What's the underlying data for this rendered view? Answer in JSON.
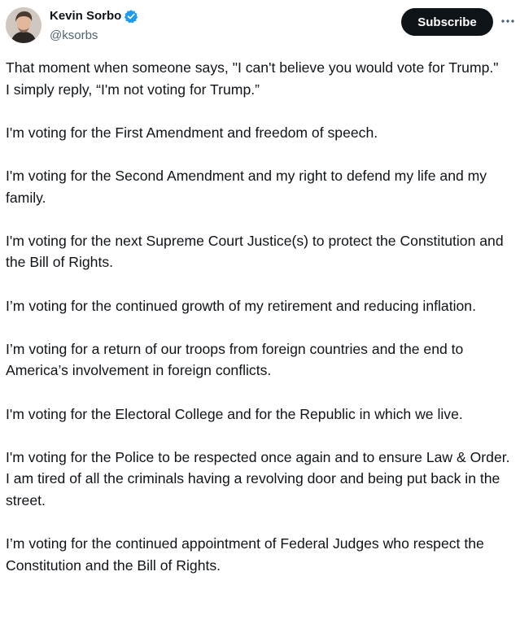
{
  "author": {
    "display_name": "Kevin Sorbo",
    "handle": "@ksorbs",
    "verified_color": "#1d9bf0"
  },
  "actions": {
    "subscribe_label": "Subscribe",
    "more_icon": "more-horizontal-icon"
  },
  "post": {
    "paragraphs": [
      "That moment when someone says, \"I can't believe you would vote for Trump.\"\nI simply reply, “I'm not voting for Trump.”",
      "I'm voting for the First Amendment and freedom of speech.",
      "I'm voting for the Second Amendment and my right to defend my life and my family.",
      "I'm voting for the next Supreme Court Justice(s) to protect the Constitution and the Bill of Rights.",
      "I’m voting for the continued growth of my retirement and reducing inflation.",
      "I’m voting for a return of our troops from foreign countries and the end to America’s involvement in foreign conflicts.",
      "I'm voting for the Electoral College and for the Republic in which we live.",
      "I'm voting for the Police to be respected once again and to ensure Law & Order. I am tired of all the criminals having a revolving door and being put back in the street.",
      "I’m voting for the continued appointment of Federal Judges who respect the Constitution and the Bill of Rights."
    ]
  }
}
